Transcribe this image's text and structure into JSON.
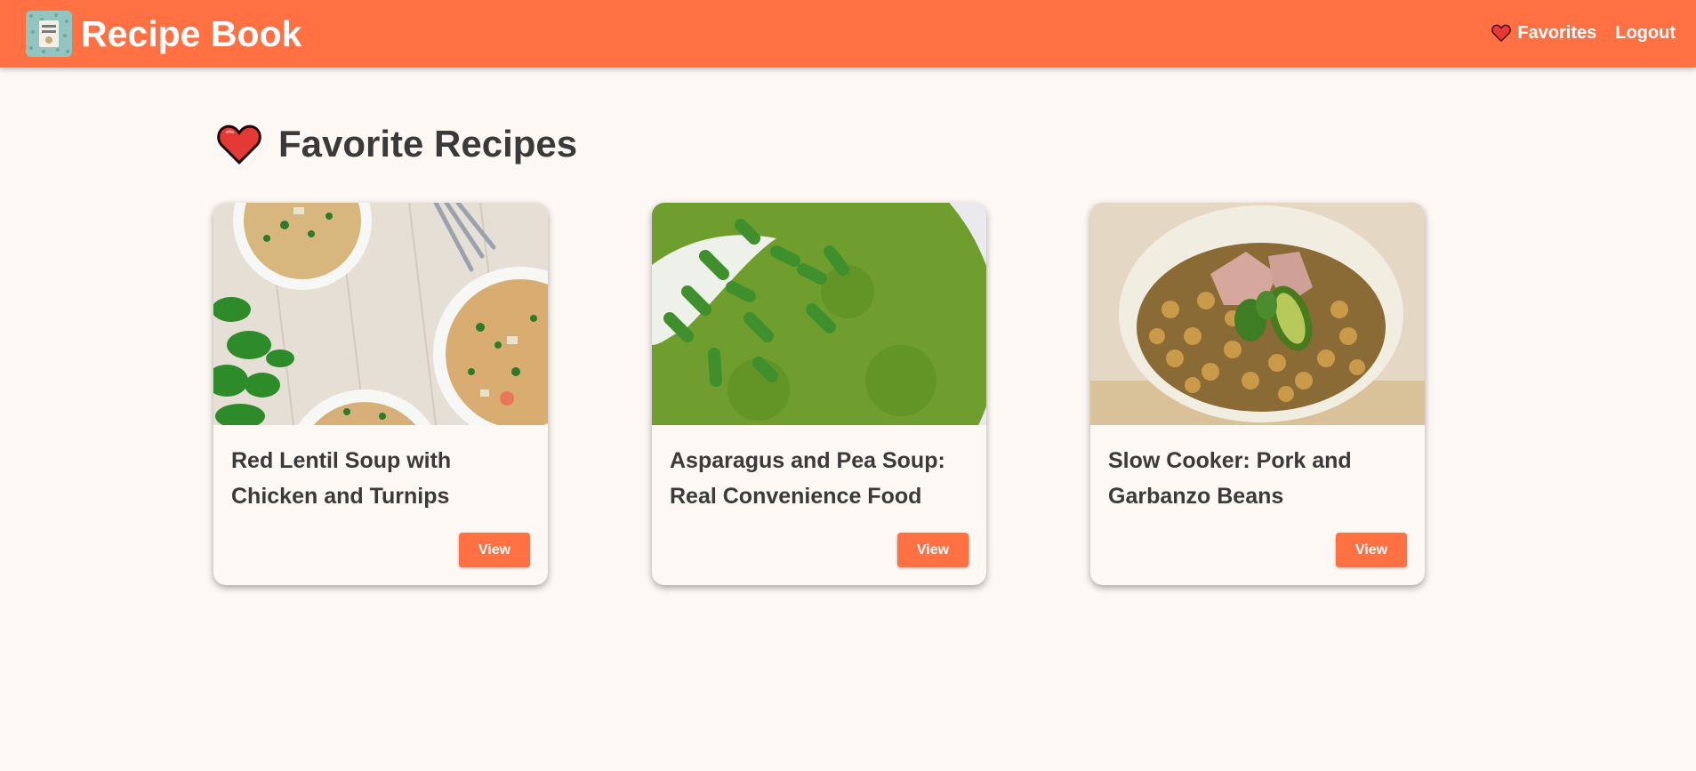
{
  "colors": {
    "accent": "#ff7043",
    "background": "#fdf8f4",
    "text": "#3a3a3a",
    "heart": "#e53935"
  },
  "navbar": {
    "brand_name": "Recipe Book",
    "brand_icon": "recipe-book-logo",
    "links": [
      {
        "label": "Favorites",
        "icon": "heart-icon"
      },
      {
        "label": "Logout"
      }
    ]
  },
  "page": {
    "title": "Favorite Recipes",
    "title_icon": "heart-icon"
  },
  "recipes": [
    {
      "title": "Red Lentil Soup with Chicken and Turnips",
      "button": "View",
      "image": "lentil-soup-photo"
    },
    {
      "title": "Asparagus and Pea Soup: Real Convenience Food",
      "button": "View",
      "image": "asparagus-pea-soup-photo"
    },
    {
      "title": "Slow Cooker: Pork and Garbanzo Beans",
      "button": "View",
      "image": "pork-garbanzo-photo"
    }
  ]
}
